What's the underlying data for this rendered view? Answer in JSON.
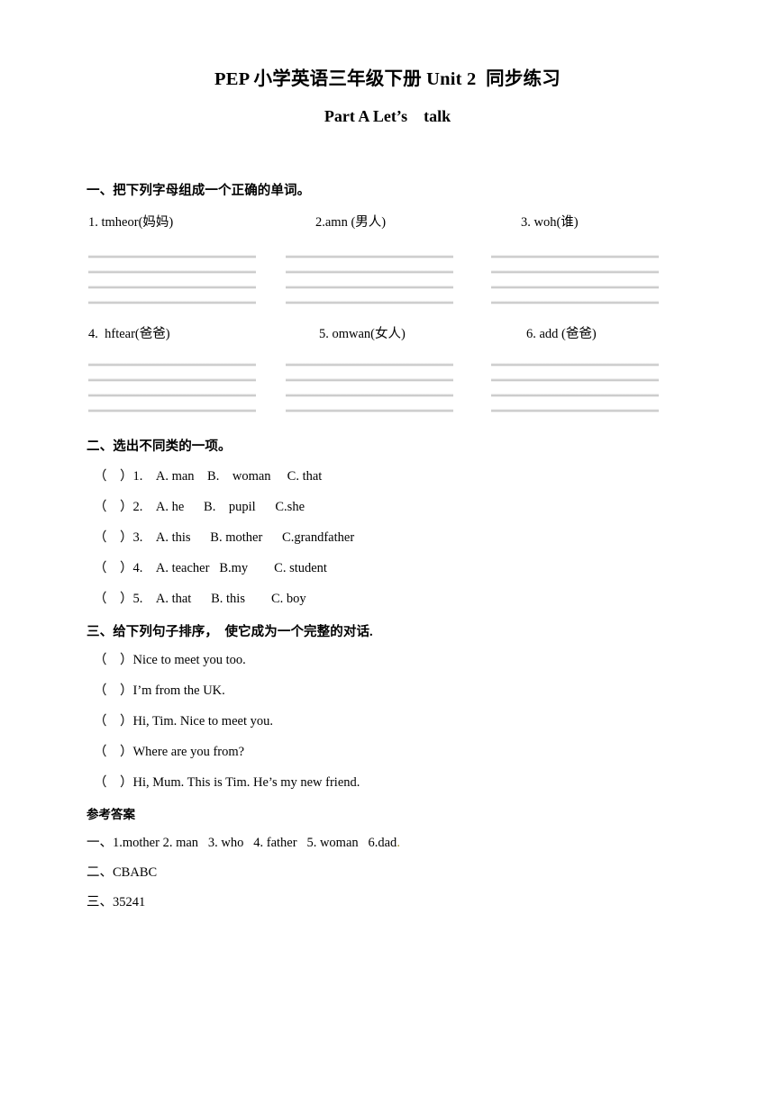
{
  "document": {
    "title_line1": "PEP 小学英语三年级下册 Unit 2  同步练习",
    "title_line2": "Part A Let’s    talk"
  },
  "section1": {
    "heading": "一、把下列字母组成一个正确的单词。",
    "words_row1": [
      "1. tmheor(妈妈)",
      "2.amn (男人)",
      "3. woh(谁)"
    ],
    "words_row2": [
      "4.  hftear(爸爸)",
      "5. omwan(女人)",
      "6. add (爸爸)"
    ],
    "guide_line_count": 4,
    "guide_column_count": 3
  },
  "section2": {
    "heading": "二、选出不同类的一项。",
    "items": [
      "（    ）1.    A. man    B.    woman     C. that",
      "（    ）2.    A. he      B.    pupil      C.she",
      "（    ）3.    A. this      B. mother      C.grandfather",
      "（    ）4.    A. teacher   B.my        C. student",
      "（    ）5.    A. that      B. this        C. boy"
    ]
  },
  "section3": {
    "heading": "三、给下列句子排序，  使它成为一个完整的对话.",
    "items": [
      "（    ）Nice to meet you too.",
      "（    ）I’m from the UK.",
      "（    ）Hi, Tim. Nice to meet you.",
      "（    ）Where are you from?",
      "（    ）Hi, Mum. This is Tim. He’s my new friend."
    ]
  },
  "answers": {
    "heading": "参考答案",
    "rows": [
      "一、1.mother 2. man   3. who   4. father   5. woman   6.dad",
      "二、CBABC",
      "三、35241"
    ],
    "trailing_mark": "."
  },
  "colors": {
    "text": "#000000",
    "background": "#ffffff",
    "guide_line": "#bdbdbd",
    "trailing_mark": "#9a8b23"
  }
}
